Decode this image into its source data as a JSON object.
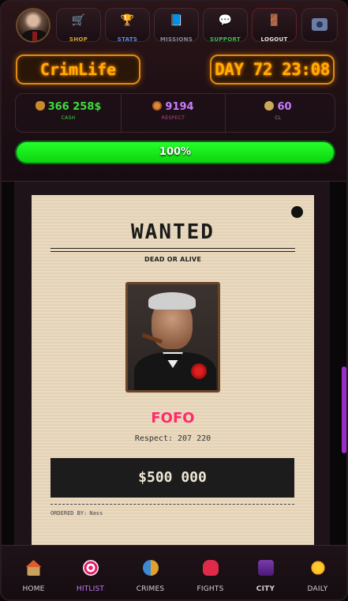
{
  "topnav": {
    "items": [
      {
        "label": "SHOP",
        "icon": "cart-icon"
      },
      {
        "label": "STATS",
        "icon": "trophy-icon"
      },
      {
        "label": "MISSIONS",
        "icon": "book-icon"
      },
      {
        "label": "SUPPORT",
        "icon": "chat-bubble-icon"
      },
      {
        "label": "LOGOUT",
        "icon": "door-icon"
      }
    ],
    "camera_icon": "camera-icon"
  },
  "brand": "CrimLife",
  "clock": "DAY 72 23:08",
  "stats": {
    "cash": {
      "value": "366 258$",
      "label": "CASH",
      "color": "#3ddc3d"
    },
    "respect": {
      "value": "9194",
      "label": "RESPECT",
      "color": "#c77cff"
    },
    "cl": {
      "value": "60",
      "label": "CL",
      "color": "#c77cff"
    }
  },
  "progress": {
    "value": 100,
    "label": "100%",
    "color": "#17e81a"
  },
  "scroll": {
    "position": 0.44,
    "visible_fraction": 0.24
  },
  "poster": {
    "heading": "WANTED",
    "subheading": "DEAD OR ALIVE",
    "target_name": "FOFO",
    "respect": "Respect: 207 220",
    "bounty": "$500 000",
    "ordered_by_label": "ORDERED BY:",
    "ordered_by_name": "Nass"
  },
  "tabbar": {
    "tabs": [
      {
        "label": "HOME",
        "icon": "house-icon"
      },
      {
        "label": "HITLIST",
        "icon": "target-icon",
        "active": true
      },
      {
        "label": "CRIMES",
        "icon": "theater-masks-icon"
      },
      {
        "label": "FIGHTS",
        "icon": "boxing-glove-icon"
      },
      {
        "label": "CITY",
        "icon": "city-icon"
      },
      {
        "label": "DAILY",
        "icon": "sun-icon"
      }
    ],
    "active_color": "#c97cff"
  }
}
